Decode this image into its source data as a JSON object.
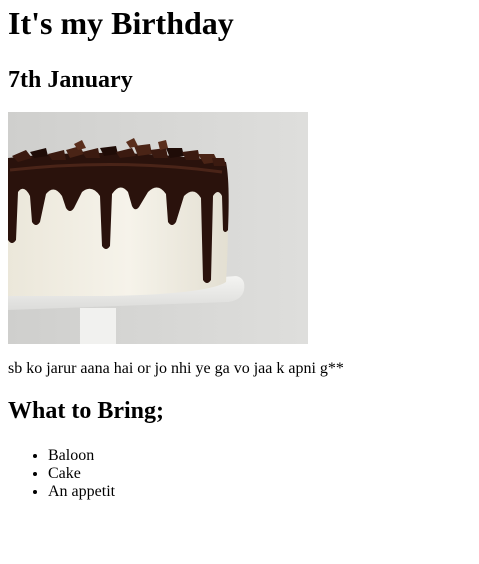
{
  "header": {
    "title": "It's my Birthday",
    "date": "7th January"
  },
  "photo": {
    "icon": "cake-photo",
    "background": "#d6d6d4",
    "frosting": "#f2efe6",
    "chocolate": "#2a120c"
  },
  "message": "sb ko jarur aana hai or jo nhi ye ga vo jaa k apni g**",
  "bring": {
    "heading": "What to Bring;",
    "items": [
      "Baloon",
      "Cake",
      "An appetit"
    ]
  }
}
